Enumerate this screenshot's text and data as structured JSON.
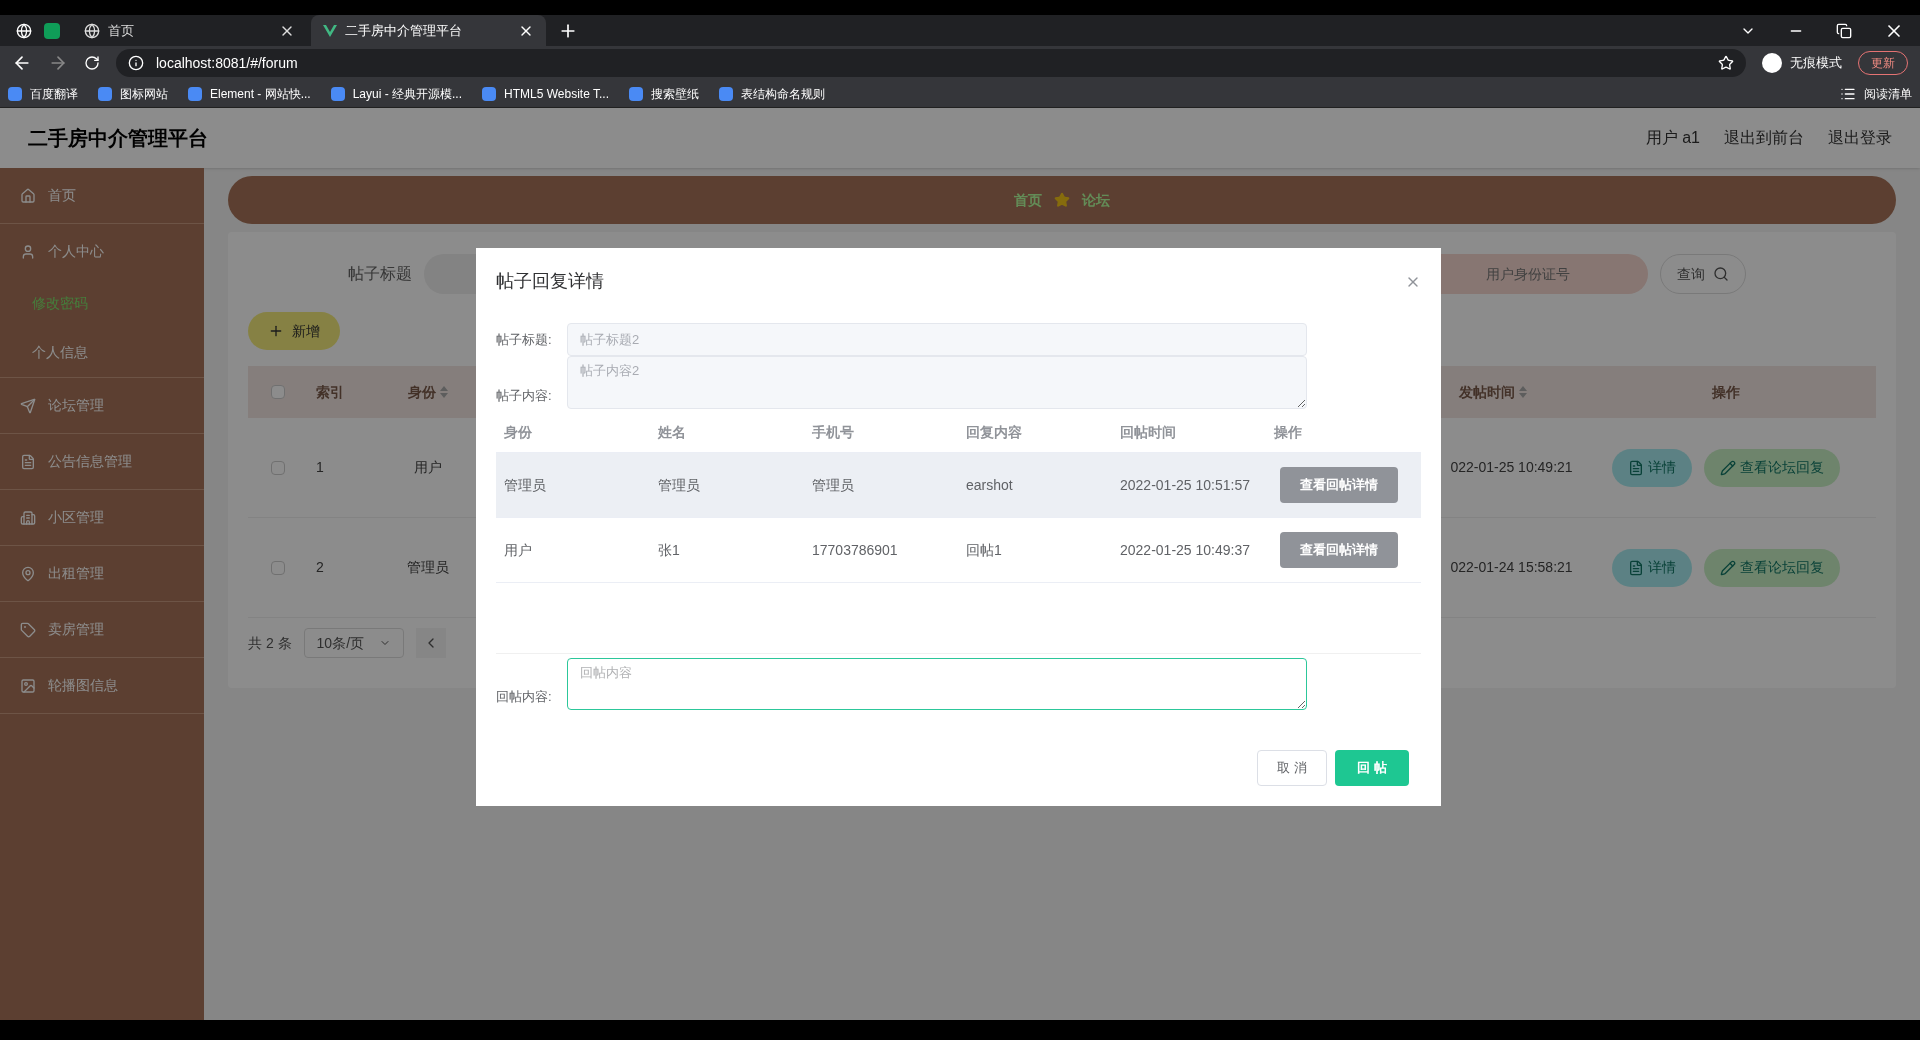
{
  "browser": {
    "tabs": [
      {
        "title": "首页",
        "selected": false
      },
      {
        "title": "二手房中介管理平台",
        "selected": true
      }
    ],
    "address": "localhost:8081/#/forum",
    "incognito_label": "无痕模式",
    "update_button": "更新",
    "bookmarks": [
      "百度翻译",
      "图标网站",
      "Element - 网站快...",
      "Layui - 经典开源模...",
      "HTML5 Website T...",
      "搜索壁纸",
      "表结构命名规则"
    ],
    "reading_list": "阅读清单"
  },
  "app": {
    "title": "二手房中介管理平台",
    "header_links": [
      "用户 a1",
      "退出到前台",
      "退出登录"
    ],
    "sidebar": [
      {
        "label": "首页"
      },
      {
        "label": "个人中心",
        "children": [
          {
            "label": "修改密码",
            "selected": true
          },
          {
            "label": "个人信息",
            "selected": false
          }
        ]
      },
      {
        "label": "论坛管理"
      },
      {
        "label": "公告信息管理"
      },
      {
        "label": "小区管理"
      },
      {
        "label": "出租管理"
      },
      {
        "label": "卖房管理"
      },
      {
        "label": "轮播图信息"
      }
    ],
    "breadcrumb": [
      "首页",
      "论坛"
    ],
    "filter_label": "帖子标题",
    "id_search_placeholder": "用户身份证号",
    "search_button": "查询",
    "add_button": "新增",
    "select_all_checked": false,
    "columns": {
      "index": "索引",
      "role": "身份",
      "time": "发帖时间",
      "actions": "操作"
    },
    "rows": [
      {
        "checked": false,
        "index": "1",
        "role": "用户",
        "time": "022-01-25 10:49:21",
        "actions": [
          "详情",
          "查看论坛回复"
        ]
      },
      {
        "checked": false,
        "index": "2",
        "role": "管理员",
        "time": "022-01-24 15:58:21",
        "actions": [
          "详情",
          "查看论坛回复"
        ]
      }
    ],
    "pagination": {
      "total": "共 2 条",
      "page_size": "10条/页"
    }
  },
  "modal": {
    "title": "帖子回复详情",
    "post_title": {
      "label": "帖子标题:",
      "value": "帖子标题2"
    },
    "post_content": {
      "label": "帖子内容:",
      "value": "帖子内容2"
    },
    "columns": [
      "身份",
      "姓名",
      "手机号",
      "回复内容",
      "回帖时间",
      "操作"
    ],
    "rows": [
      {
        "cells": [
          "管理员",
          "管理员",
          "管理员",
          "earshot",
          "2022-01-25 10:51:57"
        ],
        "button": "查看回帖详情",
        "highlighted": true
      },
      {
        "cells": [
          "用户",
          "张1",
          "17703786901",
          "回帖1",
          "2022-01-25 10:49:37"
        ],
        "button": "查看回帖详情",
        "highlighted": false
      }
    ],
    "reply": {
      "label": "回帖内容:",
      "placeholder": "回帖内容",
      "focused": true
    },
    "buttons": [
      "取 消",
      "回 帖"
    ]
  }
}
